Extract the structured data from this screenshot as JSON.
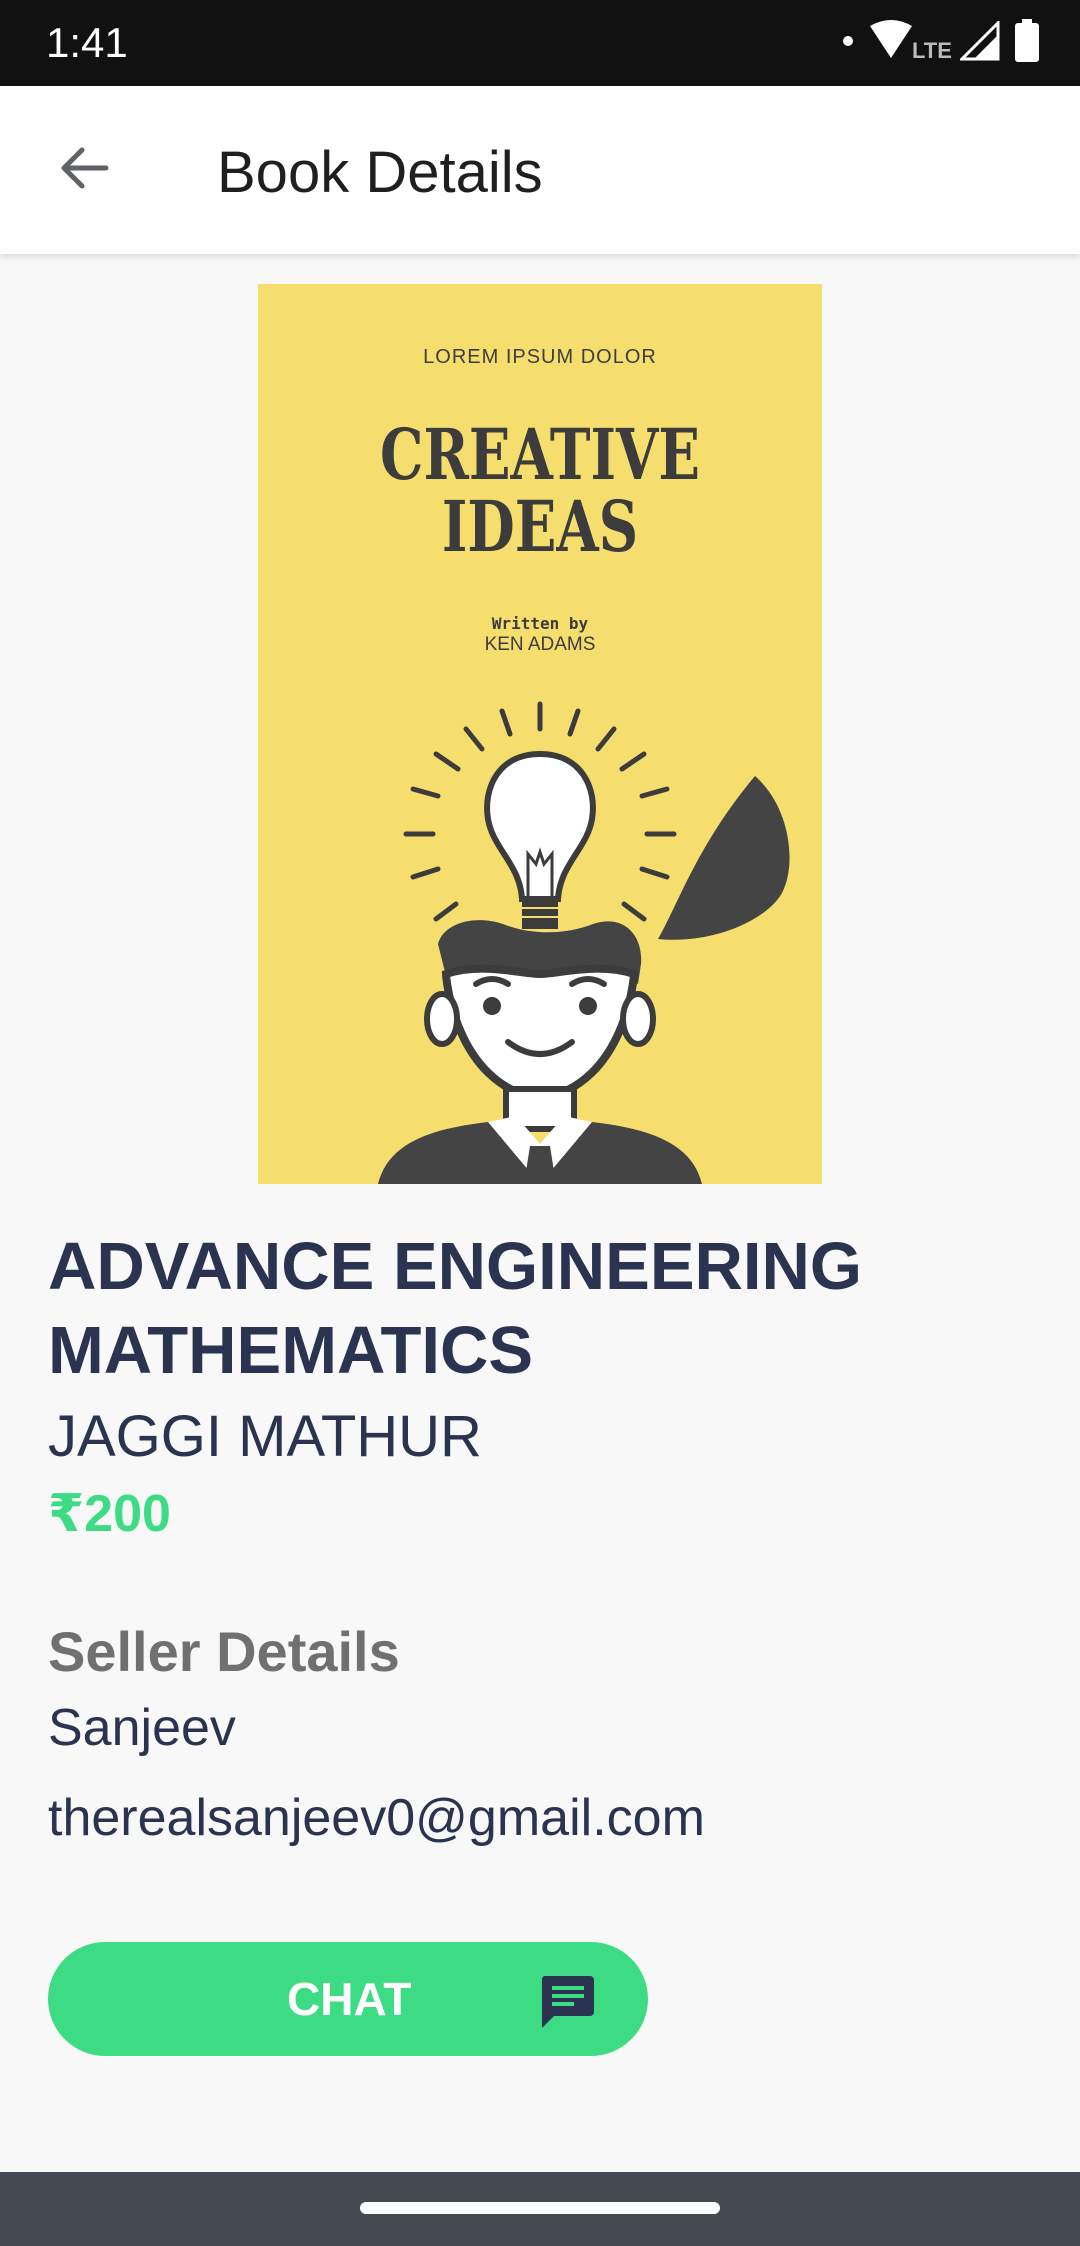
{
  "status_bar": {
    "time": "1:41",
    "network_label": "LTE",
    "icons": [
      "notification-dot-icon",
      "wifi-icon",
      "signal-icon",
      "battery-icon"
    ]
  },
  "app_bar": {
    "title": "Book Details",
    "back_icon": "arrow-left-icon"
  },
  "cover": {
    "top_text": "LOREM IPSUM DOLOR",
    "title_line1": "CREATIVE",
    "title_line2": "IDEAS",
    "written_by": "Written by",
    "author": "KEN ADAMS",
    "background_color": "#f5dd6e"
  },
  "book": {
    "title": "ADVANCE ENGINEERING MATHEMATICS",
    "author": "JAGGI MATHUR",
    "price": "₹200"
  },
  "seller": {
    "heading": "Seller Details",
    "name": "Sanjeev",
    "email": "therealsanjeev0@gmail.com"
  },
  "chat_button": {
    "label": "CHAT",
    "icon": "chat-message-icon"
  },
  "colors": {
    "accent_green": "#3ddc84",
    "text_navy": "#2a3350",
    "heading_gray": "#707070",
    "status_bar": "#111111",
    "nav_bar": "#444a52"
  }
}
